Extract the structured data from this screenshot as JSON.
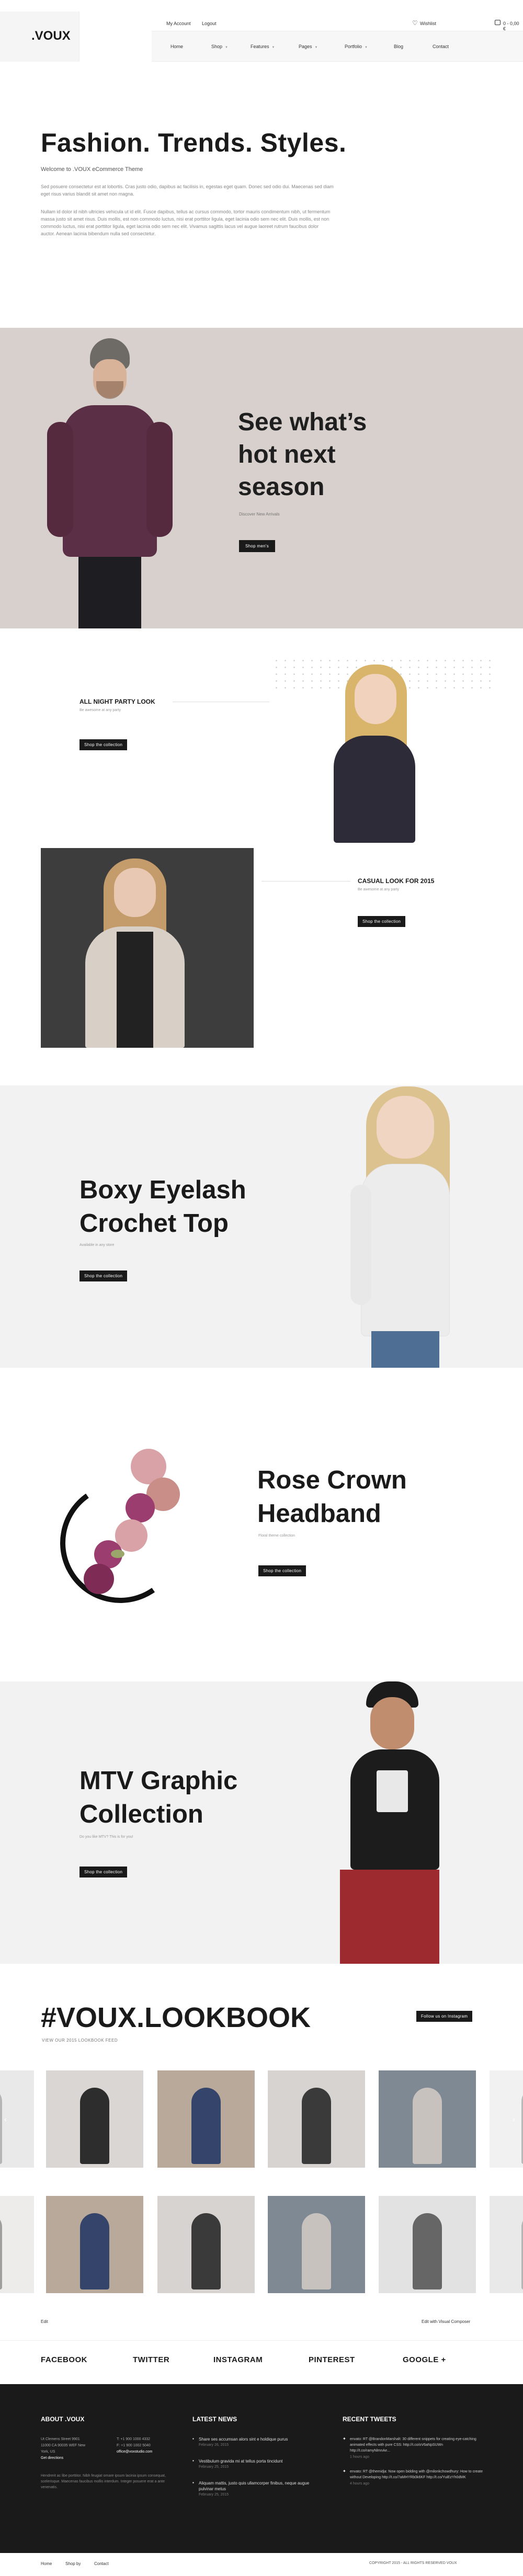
{
  "header": {
    "logo": ".VOUX",
    "top_links": [
      "My Account",
      "Logout"
    ],
    "wishlist": "Wishlist",
    "cart": "0 - 0,00 €",
    "nav": [
      {
        "label": "Home",
        "caret": false
      },
      {
        "label": "Shop",
        "caret": true
      },
      {
        "label": "Features",
        "caret": true
      },
      {
        "label": "Pages",
        "caret": true
      },
      {
        "label": "Portfolio",
        "caret": true
      },
      {
        "label": "Blog",
        "caret": false
      },
      {
        "label": "Contact",
        "caret": false
      }
    ]
  },
  "intro": {
    "title": "Fashion. Trends. Styles.",
    "subtitle": "Welcome to .VOUX eCommerce Theme",
    "p1": "Sed posuere consectetur est at lobortis. Cras justo odio, dapibus ac facilisis in, egestas eget quam. Donec sed odio dui. Maecenas sed diam eget risus varius blandit sit amet non magna.",
    "p2": "Nullam id dolor id nibh ultricies vehicula ut id elit. Fusce dapibus, tellus ac cursus commodo, tortor mauris condimentum nibh, ut fermentum massa justo sit amet risus. Duis mollis, est non commodo luctus, nisi erat porttitor ligula, eget lacinia odio sem nec elit. Duis mollis, est non commodo luctus, nisi erat porttitor ligula, eget lacinia odio sem nec elit. Vivamus sagittis lacus vel augue laoreet rutrum faucibus dolor auctor. Aenean lacinia bibendum nulla sed consectetur."
  },
  "hero": {
    "title_lines": [
      "See what’s",
      "hot next",
      "season"
    ],
    "subtitle": "Discover New Arrivals",
    "button": "Shop men's"
  },
  "party": {
    "title": "ALL NIGHT PARTY LOOK",
    "subtitle": "Be awesome at any party",
    "button": "Shop the collection"
  },
  "casual": {
    "title": "CASUAL LOOK FOR 2015",
    "subtitle": "Be awesome at any party",
    "button": "Shop the collection"
  },
  "eyelash": {
    "title_lines": [
      "Boxy Eyelash",
      "Crochet Top"
    ],
    "subtitle": "Available in any store",
    "button": "Shop the collection"
  },
  "rose": {
    "title_lines": [
      "Rose Crown",
      "Headband"
    ],
    "subtitle": "Floral theme collection",
    "button": "Shop the collection"
  },
  "mtv": {
    "title_lines": [
      "MTV Graphic",
      "Collection"
    ],
    "subtitle": "Do you like MTV? This is for you!",
    "button": "Shop the collection"
  },
  "lookbook": {
    "title": "#VOUX.LOOKBOOK",
    "subtitle": "VIEW OUR 2015 LOOKBOOK FEED",
    "follow": "Follow us on Instagram",
    "edit": "Edit",
    "edit_composer": "Edit with Visual Composer"
  },
  "social": [
    "FACEBOOK",
    "TWITTER",
    "INSTAGRAM",
    "PINTEREST",
    "GOOGLE +"
  ],
  "footer": {
    "about": {
      "title": "ABOUT .VOUX",
      "address": [
        "Ut Clemens Street 9901",
        "11000 CA 90035 WEF New",
        "York, US"
      ],
      "get_directions": "Get directions",
      "phone": "T: +1 900 1000 4332",
      "fax": "F: +1 900 1002 5040",
      "email": "office@voxstudio.com",
      "text": "Hendrerit ac libe porttitor. Nibh feugiat ornare ipsum lacinia ipsum consequat, scelerisque. Maecenas faucibus mollis interdum. Integer posuere erat a ante venenatis."
    },
    "news": {
      "title": "LATEST NEWS",
      "items": [
        {
          "title": "Share ses accumsan alors sint e holdique purus",
          "date": "February 26, 2015"
        },
        {
          "title": "Vestibulum gravida mi at tellus porta tincidunt",
          "date": "February 25, 2015"
        },
        {
          "title": "Aliquam mattis, justo quis ullamcorper finibus, neque augue pulvinar metus",
          "date": "February 25, 2015"
        }
      ]
    },
    "tweets": {
      "title": "RECENT TWEETS",
      "items": [
        {
          "text": "envato: RT @BrandonMarshalt: 30 different snippets for creating eye-catching animated effects with pure CSS: http://t.co/oV6aNpSUWn http://t.co/ramyNlmnAe...",
          "time": "1 hours ago"
        },
        {
          "text": "envato: RT @themidja: Now open bidding with @milonkchowdhury: How to create without Developing http://t.co/7aMHYRb0k6KF http://t.co/YuiEzYh0dMK",
          "time": "4 hours ago"
        }
      ]
    }
  },
  "bottom": {
    "links": [
      "Home",
      "Shop by",
      "Contact"
    ],
    "copyright": "COPYRIGHT 2015 - ALL RIGHTS RESERVED VOUX"
  }
}
